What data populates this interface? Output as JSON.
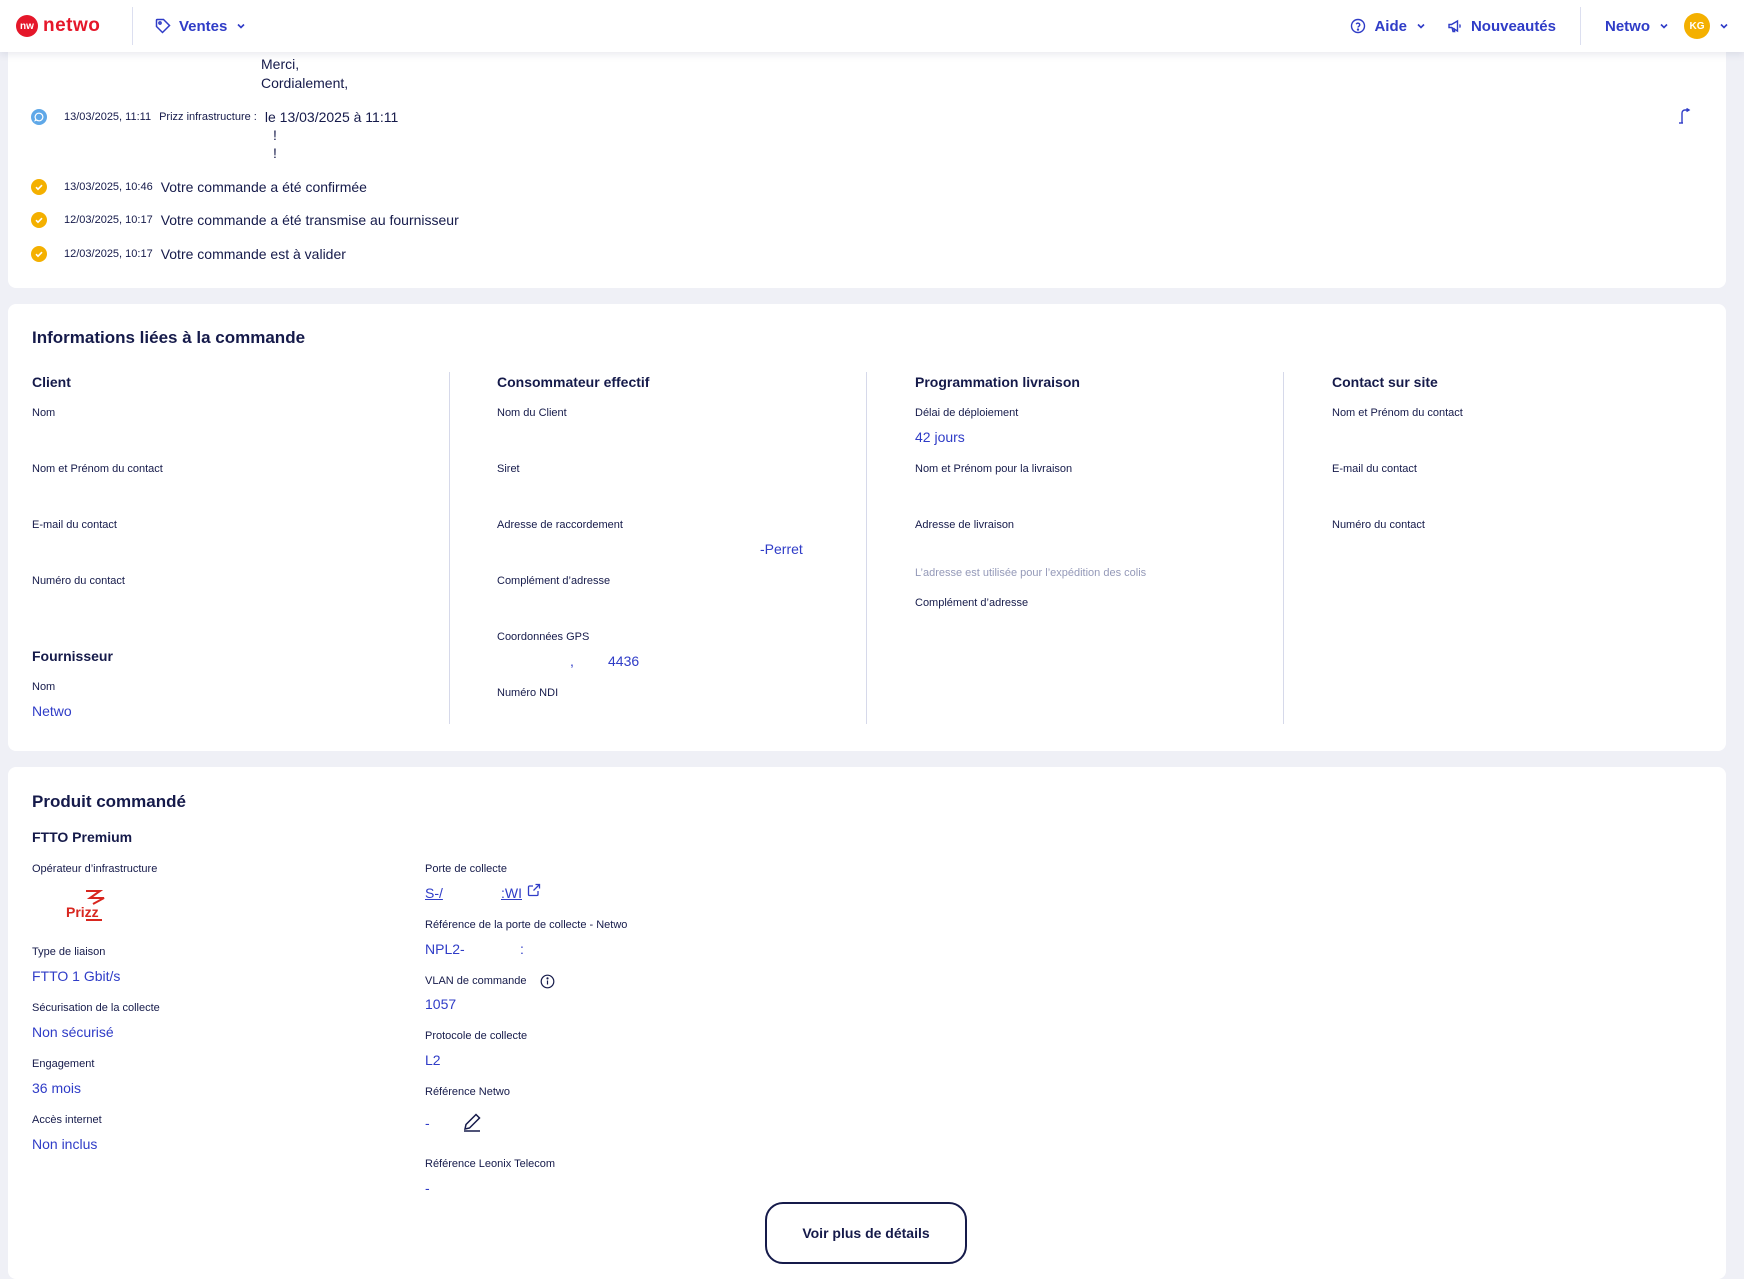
{
  "header": {
    "logo_mark": "nw",
    "logo_text": "netwo",
    "ventes_label": "Ventes",
    "aide_label": "Aide",
    "nouveautes_label": "Nouveautés",
    "account_label": "Netwo",
    "avatar_initials": "KG",
    "accent_color": "#2f3cc7",
    "brand_color": "#e5172a"
  },
  "timeline": {
    "message_tail": [
      "Merci,",
      "Cordialement,"
    ],
    "message": {
      "date": "13/03/2025, 11:11",
      "author": "Prizz infrastructure :",
      "text": "le 13/03/2025 à 11:11",
      "lines": [
        "!",
        "!"
      ]
    },
    "events": [
      {
        "date": "13/03/2025, 10:46",
        "label": "Votre commande a été confirmée"
      },
      {
        "date": "12/03/2025, 10:17",
        "label": "Votre commande a été transmise au fournisseur"
      },
      {
        "date": "12/03/2025, 10:17",
        "label": "Votre commande est à valider"
      }
    ]
  },
  "order_info": {
    "title": "Informations liées à la commande",
    "client": {
      "title": "Client",
      "nom_label": "Nom",
      "contact_name_label": "Nom et Prénom du contact",
      "contact_email_label": "E-mail du contact",
      "contact_phone_label": "Numéro du contact"
    },
    "fournisseur": {
      "title": "Fournisseur",
      "nom_label": "Nom",
      "nom_value": "Netwo"
    },
    "consommateur": {
      "title": "Consommateur effectif",
      "client_name_label": "Nom du Client",
      "siret_label": "Siret",
      "address_label": "Adresse de raccordement",
      "address_value": "-Perret",
      "complement_label": "Complément d’adresse",
      "gps_label": "Coordonnées GPS",
      "gps_value_a": ",",
      "gps_value_b": "4436",
      "ndi_label": "Numéro NDI"
    },
    "livraison": {
      "title": "Programmation livraison",
      "delay_label": "Délai de déploiement",
      "delay_value": "42 jours",
      "delivery_name_label": "Nom et Prénom pour la livraison",
      "delivery_address_label": "Adresse de livraison",
      "delivery_hint": "L’adresse est utilisée pour l’expédition des colis",
      "complement_label": "Complément d’adresse"
    },
    "contact_site": {
      "title": "Contact sur site",
      "name_label": "Nom et Prénom du contact",
      "email_label": "E-mail du contact",
      "phone_label": "Numéro du contact"
    }
  },
  "product": {
    "title": "Produit commandé",
    "name": "FTTO Premium",
    "operator_label": "Opérateur d’infrastructure",
    "operator_logo_text": "Prizz",
    "liaison_label": "Type de liaison",
    "liaison_value": "FTTO 1 Gbit/s",
    "secur_label": "Sécurisation de la collecte",
    "secur_value": "Non sécurisé",
    "engagement_label": "Engagement",
    "engagement_value": "36 mois",
    "internet_label": "Accès internet",
    "internet_value": "Non inclus",
    "porte_label": "Porte de collecte",
    "porte_value_a": "S-/",
    "porte_value_b": ":WI",
    "porte_ref_label": "Référence de la porte de collecte - Netwo",
    "porte_ref_value_a": "NPL2-",
    "porte_ref_value_b": ":",
    "vlan_label": "VLAN de commande",
    "vlan_value": "1057",
    "protocol_label": "Protocole de collecte",
    "protocol_value": "L2",
    "ref_netwo_label": "Référence Netwo",
    "ref_netwo_value": "-",
    "ref_leonix_label": "Référence Leonix Telecom",
    "ref_leonix_value": "-",
    "details_button": "Voir plus de détails"
  }
}
